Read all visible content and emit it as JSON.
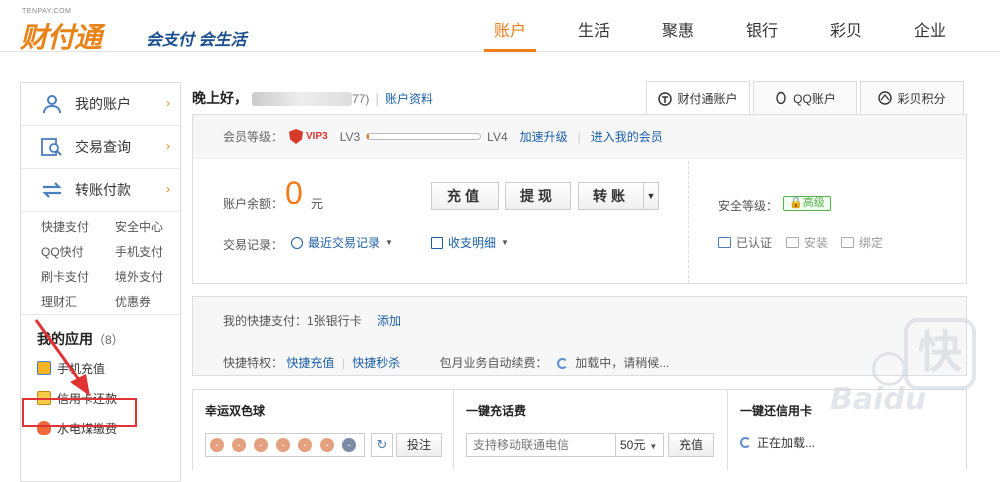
{
  "header": {
    "logo_en": "TENPAY.COM",
    "logo_cn": "财付通",
    "slogan": "会支付 会生活",
    "nav": [
      "账户",
      "生活",
      "聚惠",
      "银行",
      "彩贝",
      "企业"
    ],
    "active_nav": "账户"
  },
  "sidebar": {
    "menu": [
      {
        "label": "我的账户",
        "icon": "user-icon"
      },
      {
        "label": "交易查询",
        "icon": "search-doc-icon"
      },
      {
        "label": "转账付款",
        "icon": "transfer-arrows-icon"
      }
    ],
    "quick_links": [
      "快捷支付",
      "安全中心",
      "QQ快付",
      "手机支付",
      "刷卡支付",
      "境外支付",
      "理财汇",
      "优惠券"
    ],
    "apps_title": "我的应用",
    "apps_count": "（8）",
    "apps": [
      {
        "label": "手机充值",
        "icon": "phone-recharge-icon"
      },
      {
        "label": "信用卡还款",
        "icon": "credit-card-icon"
      },
      {
        "label": "水电煤缴费",
        "icon": "flame-icon"
      }
    ]
  },
  "greeting": {
    "text": "晚上好，",
    "tail": "77)",
    "account_info": "账户资料"
  },
  "tabs": [
    "财付通账户",
    "QQ账户",
    "彩贝积分"
  ],
  "member": {
    "label": "会员等级：",
    "vip": "VIP3",
    "lv_from": "LV3",
    "lv_to": "LV4",
    "progress": 0.02,
    "upgrade": "加速升级",
    "enter": "进入我的会员"
  },
  "balance": {
    "label": "账户余额：",
    "value": "0",
    "unit": "元",
    "recharge": "充值",
    "withdraw": "提现",
    "transfer": "转账"
  },
  "transactions": {
    "label": "交易记录：",
    "recent": "最近交易记录",
    "income": "收支明细"
  },
  "security": {
    "label": "安全等级：",
    "level": "高级",
    "verified": "已认证",
    "install": "安装",
    "bind": "绑定"
  },
  "quickpay": {
    "label": "我的快捷支付：1张银行卡",
    "add": "添加",
    "privilege_label": "快捷特权：",
    "priv1": "快捷充值",
    "priv2": "快捷秒杀",
    "auto_label": "包月业务自动续费：",
    "loading": "加载中，请稍候..."
  },
  "cards": {
    "lottery_title": "幸运双色球",
    "bet": "投注",
    "phone_title": "一键充话费",
    "phone_placeholder": "支持移动联通电信",
    "amount": "50元",
    "phone_btn": "充值",
    "card3_title": "一键还信用卡",
    "card3_loading": "正在加载..."
  },
  "colors": {
    "accent": "#f07c1a",
    "link": "#1a5fa8",
    "highlight": "#e03434",
    "secure": "#55b34e"
  }
}
